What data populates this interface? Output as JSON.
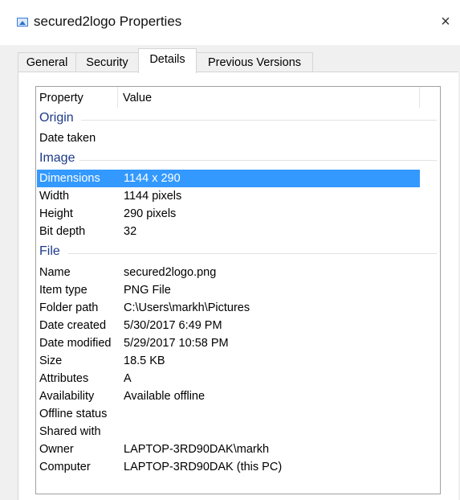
{
  "window": {
    "title": "secured2logo Properties",
    "close_label": "×",
    "accent": "#3399ff"
  },
  "tabs": [
    {
      "label": "General"
    },
    {
      "label": "Security"
    },
    {
      "label": "Details",
      "active": true
    },
    {
      "label": "Previous Versions"
    }
  ],
  "columns": {
    "property": "Property",
    "value": "Value"
  },
  "groups": {
    "origin": "Origin",
    "image": "Image",
    "file": "File"
  },
  "origin_rows": [
    {
      "key": "Date taken",
      "value": ""
    }
  ],
  "image_rows": [
    {
      "key": "Dimensions",
      "value": "1144 x 290",
      "selected": true
    },
    {
      "key": "Width",
      "value": "1144 pixels"
    },
    {
      "key": "Height",
      "value": "290 pixels"
    },
    {
      "key": "Bit depth",
      "value": "32"
    }
  ],
  "file_rows": [
    {
      "key": "Name",
      "value": "secured2logo.png"
    },
    {
      "key": "Item type",
      "value": "PNG File"
    },
    {
      "key": "Folder path",
      "value": "C:\\Users\\markh\\Pictures"
    },
    {
      "key": "Date created",
      "value": "5/30/2017 6:49 PM"
    },
    {
      "key": "Date modified",
      "value": "5/29/2017 10:58 PM"
    },
    {
      "key": "Size",
      "value": "18.5 KB"
    },
    {
      "key": "Attributes",
      "value": "A"
    },
    {
      "key": "Availability",
      "value": "Available offline"
    },
    {
      "key": "Offline status",
      "value": ""
    },
    {
      "key": "Shared with",
      "value": ""
    },
    {
      "key": "Owner",
      "value": "LAPTOP-3RD90DAK\\markh"
    },
    {
      "key": "Computer",
      "value": "LAPTOP-3RD90DAK (this PC)"
    }
  ]
}
